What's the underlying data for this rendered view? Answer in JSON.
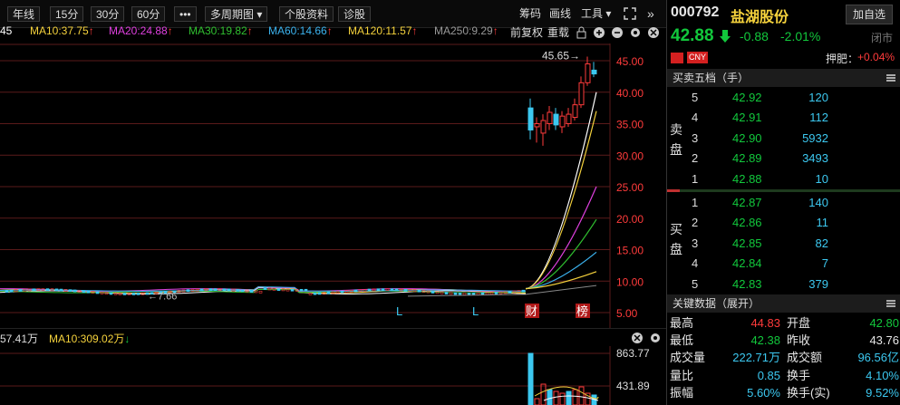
{
  "toolbar": {
    "buttons": [
      "年线",
      "15分",
      "30分",
      "60分",
      "•••",
      "多周期图 ▾",
      "个股资料",
      "诊股"
    ],
    "right": [
      "筹码",
      "画线",
      "工具 ▾"
    ]
  },
  "ma_bar": {
    "ma5": "45",
    "ma10": "MA10:37.75",
    "ma20": "MA20:24.88",
    "ma30": "MA30:19.82",
    "ma60": "MA60:14.66",
    "ma120": "MA120:11.57",
    "ma250": "MA250:9.29",
    "arrow": "↑",
    "fuquan": "前复权",
    "chongzai": "重载"
  },
  "main_chart": {
    "y_ticks": [
      "45.00",
      "40.00",
      "35.00",
      "30.00",
      "25.00",
      "20.00",
      "15.00",
      "10.00",
      "5.00"
    ],
    "high_label": "45.65→",
    "low_label": "←7.66",
    "markers": [
      "L",
      "L",
      "财",
      "榜"
    ]
  },
  "volume": {
    "label_left": "57.41万",
    "ma10": "MA10:309.02万",
    "arrow_down": "↓",
    "y_ticks": [
      "863.77",
      "431.89"
    ]
  },
  "stock": {
    "code": "000792",
    "name": "盐湖股份",
    "add_label": "加自选",
    "price": "42.88",
    "change": "-0.88",
    "pct": "-2.01%",
    "status": "闭市",
    "cny": "CNY",
    "pledge_label": "押肥：",
    "pledge_value": "+0.04%"
  },
  "order_book": {
    "title": "买卖五档（手）",
    "sell_label": "卖盘",
    "buy_label": "买盘",
    "asks": [
      {
        "level": "5",
        "price": "42.92",
        "vol": "120"
      },
      {
        "level": "4",
        "price": "42.91",
        "vol": "112"
      },
      {
        "level": "3",
        "price": "42.90",
        "vol": "5932"
      },
      {
        "level": "2",
        "price": "42.89",
        "vol": "3493"
      },
      {
        "level": "1",
        "price": "42.88",
        "vol": "10"
      }
    ],
    "bids": [
      {
        "level": "1",
        "price": "42.87",
        "vol": "140"
      },
      {
        "level": "2",
        "price": "42.86",
        "vol": "11"
      },
      {
        "level": "3",
        "price": "42.85",
        "vol": "82"
      },
      {
        "level": "4",
        "price": "42.84",
        "vol": "7"
      },
      {
        "level": "5",
        "price": "42.83",
        "vol": "379"
      }
    ]
  },
  "key_data": {
    "title": "关键数据（展开）",
    "rows": [
      {
        "l1": "最高",
        "v1": "44.83",
        "l2": "开盘",
        "v2": "42.80"
      },
      {
        "l1": "最低",
        "v1": "42.38",
        "l2": "昨收",
        "v2": "43.76"
      },
      {
        "l1": "成交量",
        "v1": "222.71万",
        "l2": "成交额",
        "v2": "96.56亿"
      },
      {
        "l1": "量比",
        "v1": "0.85",
        "l2": "换手",
        "v2": "4.10%"
      },
      {
        "l1": "振幅",
        "v1": "5.60%",
        "l2": "换手(实)",
        "v2": "9.52%"
      }
    ]
  },
  "colors": {
    "up": "#ff3b3b",
    "down": "#12c83c",
    "ma5": "#ffffff",
    "ma10": "#f5d23c",
    "ma20": "#e040e0",
    "ma30": "#30c030",
    "ma60": "#3cb4f0",
    "ma120": "#f5d23c",
    "ma250": "#888888"
  }
}
